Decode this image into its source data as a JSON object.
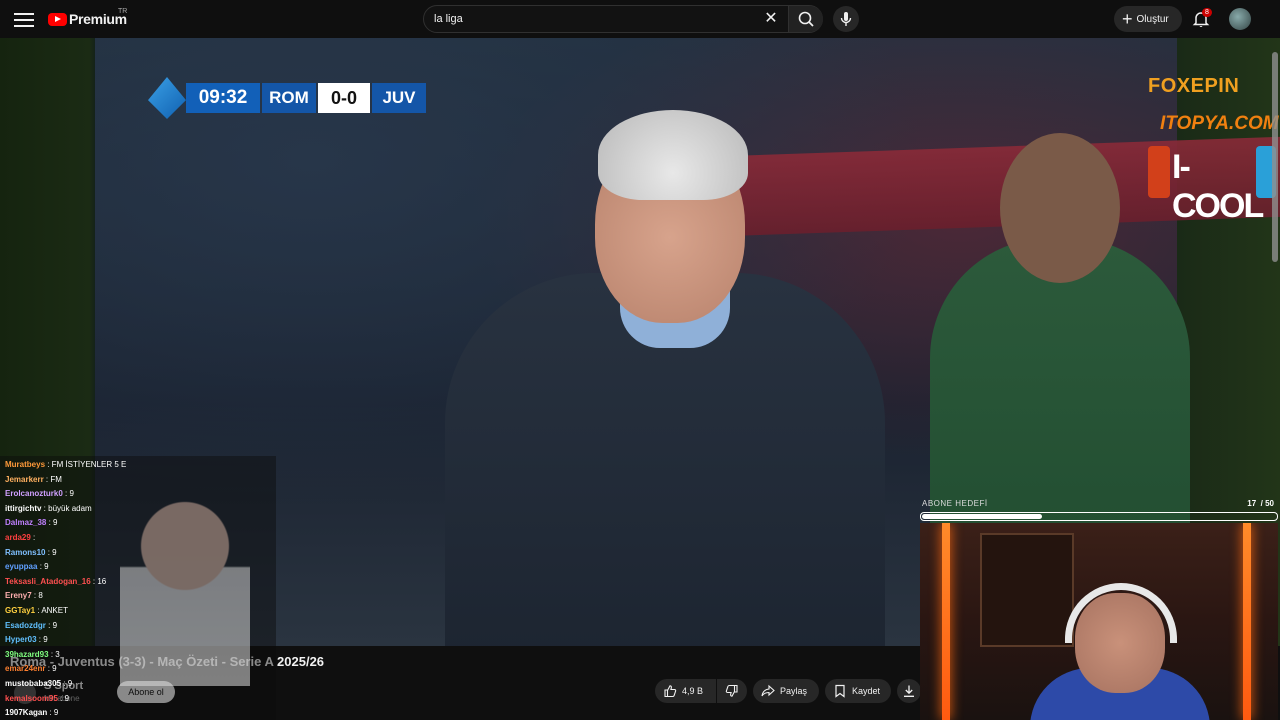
{
  "header": {
    "brand": "Premium",
    "country_code": "TR",
    "search_value": "la liga",
    "create_label": "Oluştur",
    "notification_count": "8"
  },
  "scorebug": {
    "time": "09:32",
    "home": "ROM",
    "score": "0-0",
    "away": "JUV"
  },
  "sponsors": [
    "FOXEPIN",
    "ITOPYA.COM",
    "I-COOL"
  ],
  "chat": [
    {
      "user": "Muratbeys",
      "color": "#ff9a3a",
      "msg": ": FM İSTİYENLER 5 E"
    },
    {
      "user": "Jemarkerr",
      "color": "#ffb060",
      "msg": ": FM"
    },
    {
      "user": "Erolcanozturk0",
      "color": "#d0a0ff",
      "msg": ": 9"
    },
    {
      "user": "ittirgichtv",
      "color": "#ffffff",
      "msg": ": büyük adam"
    },
    {
      "user": "Dalmaz_38",
      "color": "#c080ff",
      "msg": ": 9"
    },
    {
      "user": "arda29",
      "color": "#ff4040",
      "msg": ":"
    },
    {
      "user": "Ramons10",
      "color": "#80c0ff",
      "msg": ": 9"
    },
    {
      "user": "eyuppaa",
      "color": "#60a0ff",
      "msg": ": 9"
    },
    {
      "user": "Teksasli_Atadogan_16",
      "color": "#ff5050",
      "msg": ": 16"
    },
    {
      "user": "Ereny7",
      "color": "#ffb0b0",
      "msg": ": 8"
    },
    {
      "user": "GGTay1",
      "color": "#ffd040",
      "msg": ": ANKET"
    },
    {
      "user": "Esadozdgr",
      "color": "#60c0ff",
      "msg": ": 9"
    },
    {
      "user": "Hyper03",
      "color": "#60c0ff",
      "msg": ": 9"
    },
    {
      "user": "39hazard93",
      "color": "#80ff80",
      "msg": ": 3"
    },
    {
      "user": "emar24enr",
      "color": "#ff8030",
      "msg": ": 9"
    },
    {
      "user": "mustobaba305",
      "color": "#ffffff",
      "msg": ": 9"
    },
    {
      "user": "kemalsoom95",
      "color": "#ff5050",
      "msg": ": 9"
    },
    {
      "user": "1907Kagan",
      "color": "#ffffff",
      "msg": ": 9"
    }
  ],
  "video": {
    "title": "Roma - Juventus (3-3) - Maç Özeti - Serie A 2025/26",
    "channel": "S Sport",
    "subscribers": "Mn abone",
    "subscribe_label": "Abone ol",
    "likes": "4,9 B",
    "share_label": "Paylaş",
    "save_label": "Kaydet"
  },
  "goal": {
    "label": "ABONE HEDEFİ",
    "current": "17",
    "target": "/ 50",
    "progress": 0.34
  }
}
